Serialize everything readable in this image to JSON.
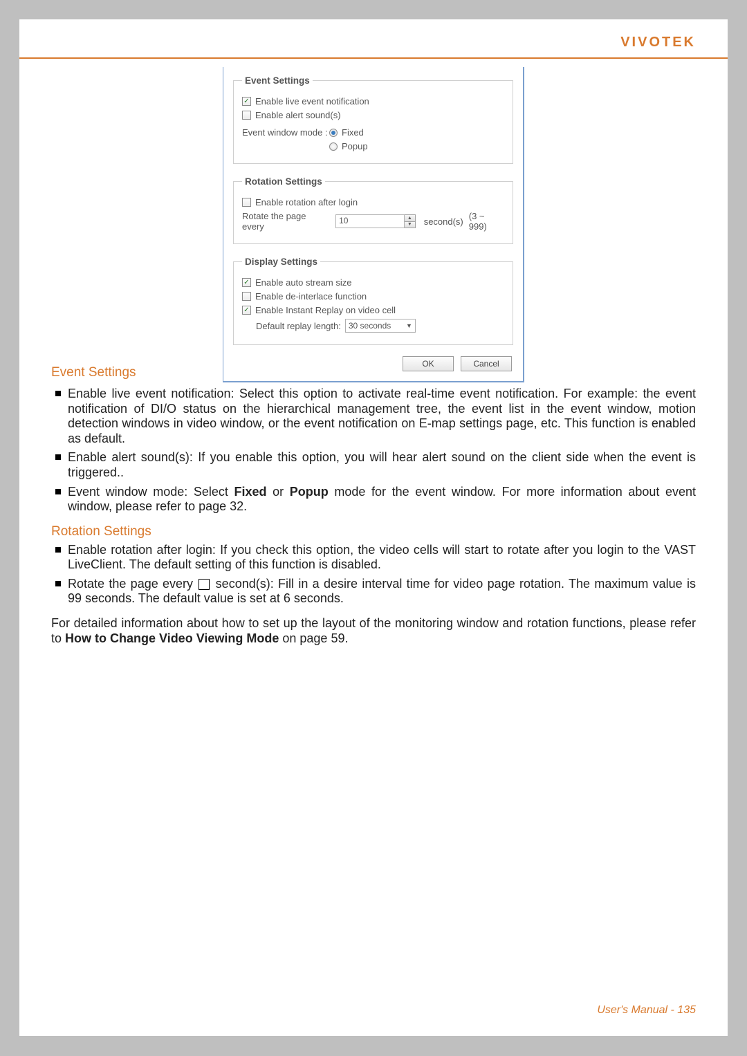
{
  "header": {
    "brand": "VIVOTEK"
  },
  "dialog": {
    "event_settings": {
      "legend": "Event Settings",
      "enable_live_notification": {
        "label": "Enable live event notification",
        "checked": true
      },
      "enable_alert_sounds": {
        "label": "Enable alert sound(s)",
        "checked": false
      },
      "window_mode_label": "Event window mode :",
      "fixed": {
        "label": "Fixed",
        "checked": true
      },
      "popup": {
        "label": "Popup",
        "checked": false
      }
    },
    "rotation_settings": {
      "legend": "Rotation Settings",
      "enable_rotation": {
        "label": "Enable rotation after login",
        "checked": false
      },
      "rotate_label": "Rotate the page every",
      "rotate_value": "10",
      "rotate_unit": "second(s)",
      "rotate_range": "(3 ~ 999)"
    },
    "display_settings": {
      "legend": "Display Settings",
      "auto_stream": {
        "label": "Enable auto stream size",
        "checked": true
      },
      "deinterlace": {
        "label": "Enable de-interlace function",
        "checked": false
      },
      "instant_replay": {
        "label": "Enable Instant Replay on video cell",
        "checked": true
      },
      "replay_len_label": "Default replay length:",
      "replay_len_value": "30 seconds"
    },
    "buttons": {
      "ok": "OK",
      "cancel": "Cancel"
    }
  },
  "doc": {
    "event_heading": "Event Settings",
    "event_b1a": "Enable live event notification: Select this option to activate real-time event notification. For example: the event notification of DI/O status on the hierarchical management tree, the event list in the event window, motion detection windows in video window, or the event notification on E-map settings page, etc. This function is enabled as default.",
    "event_b2": "Enable alert sound(s): If you enable this option, you will hear alert sound on the client side when the event is triggered..",
    "event_b3a": "Event window mode: Select ",
    "event_b3_fixed": "Fixed",
    "event_b3_mid": " or ",
    "event_b3_popup": "Popup",
    "event_b3b": " mode for the event window. For more information about event window, please refer to page 32.",
    "rotation_heading": "Rotation Settings",
    "rot_b1": "Enable rotation after login: If you check this option, the video cells will start to rotate after you login to the VAST LiveClient. The default setting of this function is disabled.",
    "rot_b2a": "Rotate the page every ",
    "rot_b2b": " second(s): Fill in a desire interval time for video page rotation. The maximum value is 99 seconds. The default value is set at 6 seconds.",
    "para_a": "For detailed information about how to set up the layout of the monitoring window and rotation functions, please refer to ",
    "para_bold": "How to Change Video Viewing Mode",
    "para_b": " on page 59."
  },
  "footer": {
    "label": "User's Manual - ",
    "page": "135"
  }
}
